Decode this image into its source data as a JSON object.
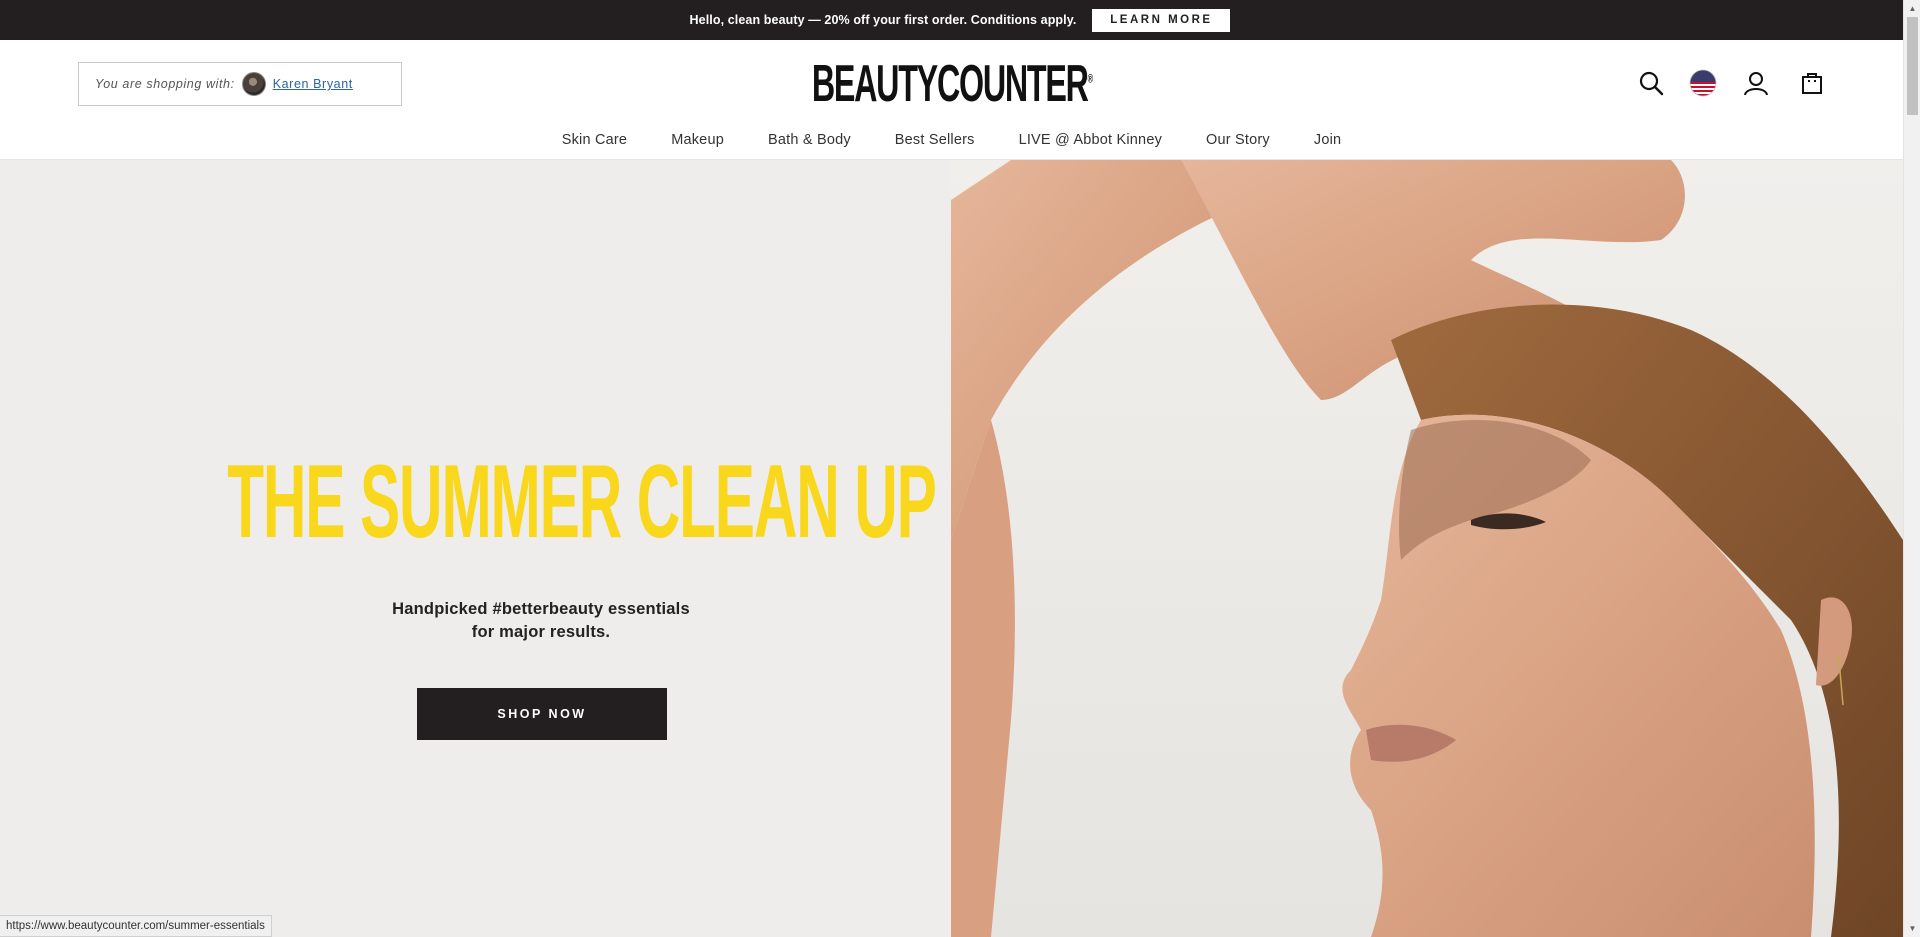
{
  "promo": {
    "text": "Hello, clean beauty — 20% off your first order. Conditions apply.",
    "button_label": "LEARN MORE"
  },
  "header": {
    "shopping_with_label": "You are shopping with:",
    "consultant_name": "Karen Bryant",
    "logo_text": "BEAUTYCOUNTER",
    "logo_mark": "®",
    "icons": [
      "search-icon",
      "us-flag-icon",
      "account-icon",
      "shopping-bag-icon"
    ]
  },
  "nav": {
    "items": [
      {
        "label": "Skin Care"
      },
      {
        "label": "Makeup"
      },
      {
        "label": "Bath & Body"
      },
      {
        "label": "Best Sellers"
      },
      {
        "label": "LIVE @ Abbot Kinney"
      },
      {
        "label": "Our Story"
      },
      {
        "label": "Join"
      }
    ]
  },
  "hero": {
    "title": "THE SUMMER CLEAN UP",
    "subtitle_line1": "Handpicked #betterbeauty essentials",
    "subtitle_line2": "for major results.",
    "cta_label": "SHOP NOW",
    "title_color": "#f9d71c"
  },
  "status_bar": {
    "url": "https://www.beautycounter.com/summer-essentials"
  },
  "colors": {
    "dark": "#231f20",
    "hero_bg": "#efedeb",
    "link": "#2a63a8"
  }
}
